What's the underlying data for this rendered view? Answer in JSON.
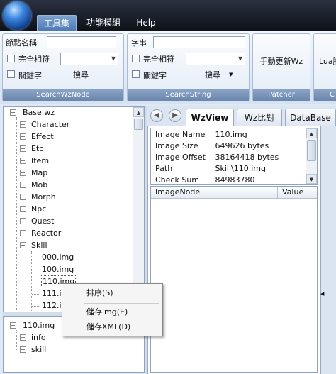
{
  "menubar": {
    "tabs": [
      "工具集",
      "功能模組",
      "Help"
    ]
  },
  "ribbon": {
    "search_node": {
      "node_name_label": "節點名稱",
      "exact_match_label": "完全相符",
      "keyword_label": "關鍵字",
      "search_label": "搜尋",
      "caption": "SearchWzNode"
    },
    "search_string": {
      "string_label": "字串",
      "exact_match_label": "完全相符",
      "keyword_label": "關鍵字",
      "search_label": "搜尋",
      "caption": "SearchString"
    },
    "patcher": {
      "button_label": "手動更新Wz",
      "caption": "Patcher"
    },
    "lua": {
      "button_label": "Lua腳",
      "caption": "C"
    }
  },
  "tree": {
    "root": "Base.wz",
    "items": [
      "Character",
      "Effect",
      "Etc",
      "Item",
      "Map",
      "Mob",
      "Morph",
      "Npc",
      "Quest",
      "Reactor",
      "Skill"
    ],
    "skill_children": [
      "000.img",
      "100.img",
      "110.img",
      "111.img",
      "112.img"
    ]
  },
  "subtree": {
    "root": "110.img",
    "items": [
      "info",
      "skill"
    ]
  },
  "tabs": {
    "wzview": "WzView",
    "wzcompare": "Wz比對",
    "database": "DataBase"
  },
  "info": {
    "rows": [
      {
        "key": "Image Name",
        "value": "110.img"
      },
      {
        "key": "Image Size",
        "value": "649626 bytes"
      },
      {
        "key": "Image Offset",
        "value": "38164418 bytes"
      },
      {
        "key": "Path",
        "value": "Skill\\110.img"
      },
      {
        "key": "Check Sum",
        "value": "84983780"
      }
    ]
  },
  "grid": {
    "col1": "ImageNode",
    "col2": "Value"
  },
  "context_menu": {
    "items": [
      "排序(S)",
      "儲存img(E)",
      "儲存XML(D)"
    ]
  },
  "icons": {
    "back": "back-arrow-icon",
    "forward": "forward-arrow-icon",
    "dropdown": "chevron-down-icon"
  }
}
